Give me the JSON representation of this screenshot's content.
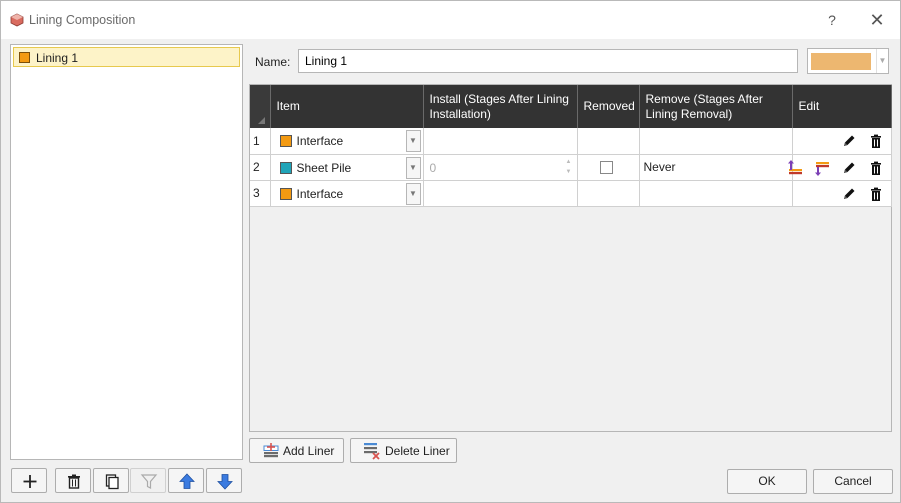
{
  "window": {
    "title": "Lining Composition",
    "help_symbol": "?",
    "close_symbol": "✕"
  },
  "linings": [
    {
      "label": "Lining 1",
      "color": "#f39a12"
    }
  ],
  "name_label": "Name:",
  "name_value": "Lining 1",
  "lining_color": "#edb770",
  "columns": {
    "item": "Item",
    "install": "Install (Stages After Lining Installation)",
    "removed": "Removed",
    "remove": "Remove (Stages After Lining Removal)",
    "edit": "Edit"
  },
  "rows": [
    {
      "num": "1",
      "item": "Interface",
      "item_color": "#f39a12",
      "install": "",
      "removed": false,
      "remove": "",
      "extra_icons": false
    },
    {
      "num": "2",
      "item": "Sheet Pile",
      "item_color": "#20a4b8",
      "install": "0",
      "removed": false,
      "remove": "Never",
      "extra_icons": true
    },
    {
      "num": "3",
      "item": "Interface",
      "item_color": "#f39a12",
      "install": "",
      "removed": false,
      "remove": "",
      "extra_icons": false
    }
  ],
  "buttons": {
    "add_liner": "Add Liner",
    "delete_liner": "Delete Liner",
    "ok": "OK",
    "cancel": "Cancel"
  },
  "toolbar_icons": [
    "add-icon",
    "delete-icon",
    "copy-icon",
    "filter-icon",
    "move-up-icon",
    "move-down-icon"
  ]
}
